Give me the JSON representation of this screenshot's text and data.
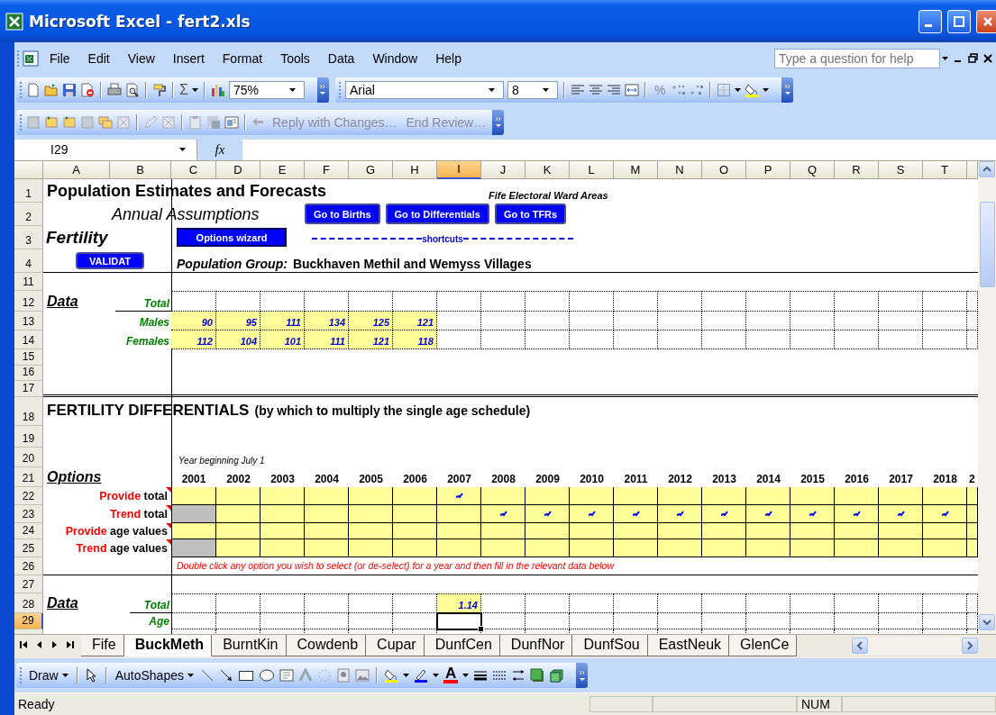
{
  "window": {
    "title": "Microsoft Excel - fert2.xls"
  },
  "menu_bar": {
    "items": [
      "File",
      "Edit",
      "View",
      "Insert",
      "Format",
      "Tools",
      "Data",
      "Window",
      "Help"
    ],
    "search": {
      "placeholder": "Type a question for help"
    }
  },
  "standard_toolbar": {
    "autosum": "Σ",
    "zoom": "75%"
  },
  "formatting_toolbar": {
    "font": "Arial",
    "size": "8",
    "percent": "%"
  },
  "reviewing_toolbar": {
    "buttons": [
      "Reply with Changes…",
      "End Review…"
    ]
  },
  "formula_bar": {
    "name_box": "I29",
    "function_label": "fx"
  },
  "column_headers": [
    {
      "label": "A",
      "selected": false
    },
    {
      "label": "B",
      "selected": false
    },
    {
      "label": "C",
      "selected": false
    },
    {
      "label": "D",
      "selected": false
    },
    {
      "label": "E",
      "selected": false
    },
    {
      "label": "F",
      "selected": false
    },
    {
      "label": "G",
      "selected": false
    },
    {
      "label": "H",
      "selected": false
    },
    {
      "label": "I",
      "selected": true
    },
    {
      "label": "J",
      "selected": false
    },
    {
      "label": "K",
      "selected": false
    },
    {
      "label": "L",
      "selected": false
    },
    {
      "label": "M",
      "selected": false
    },
    {
      "label": "N",
      "selected": false
    },
    {
      "label": "O",
      "selected": false
    },
    {
      "label": "P",
      "selected": false
    },
    {
      "label": "Q",
      "selected": false
    },
    {
      "label": "R",
      "selected": false
    },
    {
      "label": "S",
      "selected": false
    },
    {
      "label": "T",
      "selected": false
    }
  ],
  "row_headers": [
    {
      "label": "1",
      "selected": false
    },
    {
      "label": "2",
      "selected": false
    },
    {
      "label": "3",
      "selected": false
    },
    {
      "label": "4",
      "selected": false
    },
    {
      "label": "11",
      "selected": false
    },
    {
      "label": "12",
      "selected": false
    },
    {
      "label": "13",
      "selected": false
    },
    {
      "label": "14",
      "selected": false
    },
    {
      "label": "15",
      "selected": false
    },
    {
      "label": "16",
      "selected": false
    },
    {
      "label": "17",
      "selected": false
    },
    {
      "label": "18",
      "selected": false
    },
    {
      "label": "19",
      "selected": false
    },
    {
      "label": "20",
      "selected": false
    },
    {
      "label": "21",
      "selected": false
    },
    {
      "label": "22",
      "selected": false
    },
    {
      "label": "23",
      "selected": false
    },
    {
      "label": "24",
      "selected": false
    },
    {
      "label": "25",
      "selected": false
    },
    {
      "label": "26",
      "selected": false
    },
    {
      "label": "27",
      "selected": false
    },
    {
      "label": "28",
      "selected": false
    },
    {
      "label": "29",
      "selected": true
    }
  ],
  "sheet": {
    "title": "Population Estimates and Forecasts",
    "area": "Fife Electoral Ward Areas",
    "subtitle": "Annual Assumptions",
    "topic": "Fertility",
    "nav_buttons": [
      "Go to Births",
      "Go to Differentials",
      "Go to TFRs"
    ],
    "wizard_button": "Options wizard",
    "validate_button": "VALIDAT",
    "shortcuts_label": "shortcuts",
    "group_label": "Population Group:",
    "group_name": "Buckhaven Methil and Wemyss Villages",
    "counts": {
      "label": "Data",
      "rows": [
        {
          "label": "Total"
        },
        {
          "label": "Males",
          "values": [
            "90",
            "95",
            "111",
            "134",
            "125",
            "121"
          ]
        },
        {
          "label": "Females",
          "values": [
            "112",
            "104",
            "101",
            "111",
            "121",
            "118"
          ]
        }
      ]
    },
    "differentials": {
      "heading": "FERTILITY DIFFERENTIALS",
      "note": "(by which to multiply the single age schedule)",
      "year_caption": "Year beginning July 1",
      "options_label": "Options",
      "years": [
        {
          "label": "2001"
        },
        {
          "label": "2002"
        },
        {
          "label": "2003"
        },
        {
          "label": "2004"
        },
        {
          "label": "2005"
        },
        {
          "label": "2006"
        },
        {
          "label": "2007",
          "total": "1.14"
        },
        {
          "label": "2008"
        },
        {
          "label": "2009"
        },
        {
          "label": "2010"
        },
        {
          "label": "2011"
        },
        {
          "label": "2012"
        },
        {
          "label": "2013"
        },
        {
          "label": "2014"
        },
        {
          "label": "2015"
        },
        {
          "label": "2016"
        },
        {
          "label": "2017"
        },
        {
          "label": "2018"
        },
        {
          "label": "2"
        }
      ],
      "options": [
        {
          "keyword": "Provide",
          "rest": "total",
          "comment": true,
          "cells": [
            {
              "kind": "open",
              "checked": false
            },
            {
              "kind": "open",
              "checked": false
            },
            {
              "kind": "open",
              "checked": false
            },
            {
              "kind": "open",
              "checked": false
            },
            {
              "kind": "open",
              "checked": false
            },
            {
              "kind": "open",
              "checked": false
            },
            {
              "kind": "open",
              "checked": true
            },
            {
              "kind": "open",
              "checked": false
            },
            {
              "kind": "open",
              "checked": false
            },
            {
              "kind": "open",
              "checked": false
            },
            {
              "kind": "open",
              "checked": false
            },
            {
              "kind": "open",
              "checked": false
            },
            {
              "kind": "open",
              "checked": false
            },
            {
              "kind": "open",
              "checked": false
            },
            {
              "kind": "open",
              "checked": false
            },
            {
              "kind": "open",
              "checked": false
            },
            {
              "kind": "open",
              "checked": false
            },
            {
              "kind": "open",
              "checked": false
            },
            {
              "kind": "open",
              "checked": false
            }
          ]
        },
        {
          "keyword": "Trend",
          "rest": "total",
          "comment": true,
          "cells": [
            {
              "kind": "blocked",
              "checked": false
            },
            {
              "kind": "open",
              "checked": false
            },
            {
              "kind": "open",
              "checked": false
            },
            {
              "kind": "open",
              "checked": false
            },
            {
              "kind": "open",
              "checked": false
            },
            {
              "kind": "open",
              "checked": false
            },
            {
              "kind": "open",
              "checked": false
            },
            {
              "kind": "open",
              "checked": true
            },
            {
              "kind": "open",
              "checked": true
            },
            {
              "kind": "open",
              "checked": true
            },
            {
              "kind": "open",
              "checked": true
            },
            {
              "kind": "open",
              "checked": true
            },
            {
              "kind": "open",
              "checked": true
            },
            {
              "kind": "open",
              "checked": true
            },
            {
              "kind": "open",
              "checked": true
            },
            {
              "kind": "open",
              "checked": true
            },
            {
              "kind": "open",
              "checked": true
            },
            {
              "kind": "open",
              "checked": true
            },
            {
              "kind": "open",
              "checked": false
            }
          ]
        },
        {
          "keyword": "Provide",
          "rest": "age values",
          "comment": true,
          "cells": [
            {
              "kind": "open",
              "checked": false
            },
            {
              "kind": "open",
              "checked": false
            },
            {
              "kind": "open",
              "checked": false
            },
            {
              "kind": "open",
              "checked": false
            },
            {
              "kind": "open",
              "checked": false
            },
            {
              "kind": "open",
              "checked": false
            },
            {
              "kind": "open",
              "checked": false
            },
            {
              "kind": "open",
              "checked": false
            },
            {
              "kind": "open",
              "checked": false
            },
            {
              "kind": "open",
              "checked": false
            },
            {
              "kind": "open",
              "checked": false
            },
            {
              "kind": "open",
              "checked": false
            },
            {
              "kind": "open",
              "checked": false
            },
            {
              "kind": "open",
              "checked": false
            },
            {
              "kind": "open",
              "checked": false
            },
            {
              "kind": "open",
              "checked": false
            },
            {
              "kind": "open",
              "checked": false
            },
            {
              "kind": "open",
              "checked": false
            },
            {
              "kind": "open",
              "checked": false
            }
          ]
        },
        {
          "keyword": "Trend",
          "rest": "age values",
          "comment": true,
          "cells": [
            {
              "kind": "blocked",
              "checked": false
            },
            {
              "kind": "open",
              "checked": false
            },
            {
              "kind": "open",
              "checked": false
            },
            {
              "kind": "open",
              "checked": false
            },
            {
              "kind": "open",
              "checked": false
            },
            {
              "kind": "open",
              "checked": false
            },
            {
              "kind": "open",
              "checked": false
            },
            {
              "kind": "open",
              "checked": false
            },
            {
              "kind": "open",
              "checked": false
            },
            {
              "kind": "open",
              "checked": false
            },
            {
              "kind": "open",
              "checked": false
            },
            {
              "kind": "open",
              "checked": false
            },
            {
              "kind": "open",
              "checked": false
            },
            {
              "kind": "open",
              "checked": false
            },
            {
              "kind": "open",
              "checked": false
            },
            {
              "kind": "open",
              "checked": false
            },
            {
              "kind": "open",
              "checked": false
            },
            {
              "kind": "open",
              "checked": false
            },
            {
              "kind": "open",
              "checked": false
            }
          ]
        }
      ],
      "hint": "Double click any option you wish to select (or de-select) for a year and then fill in the relevant data below",
      "data_label": "Data",
      "data_rows": [
        "Total",
        "Age"
      ]
    }
  },
  "sheet_tabs": [
    {
      "label": "Fife",
      "selected": false
    },
    {
      "label": "BuckMeth",
      "selected": true
    },
    {
      "label": "BurntKin",
      "selected": false
    },
    {
      "label": "Cowdenb",
      "selected": false
    },
    {
      "label": "Cupar",
      "selected": false
    },
    {
      "label": "DunfCen",
      "selected": false
    },
    {
      "label": "DunfNor",
      "selected": false
    },
    {
      "label": "DunfSou",
      "selected": false
    },
    {
      "label": "EastNeuk",
      "selected": false
    },
    {
      "label": "GlenCe",
      "selected": false
    }
  ],
  "drawing_toolbar": {
    "draw": "Draw",
    "autoshapes": "AutoShapes",
    "font_color": "A"
  },
  "status_bar": {
    "status": "Ready",
    "indicators": [
      "NUM"
    ]
  }
}
